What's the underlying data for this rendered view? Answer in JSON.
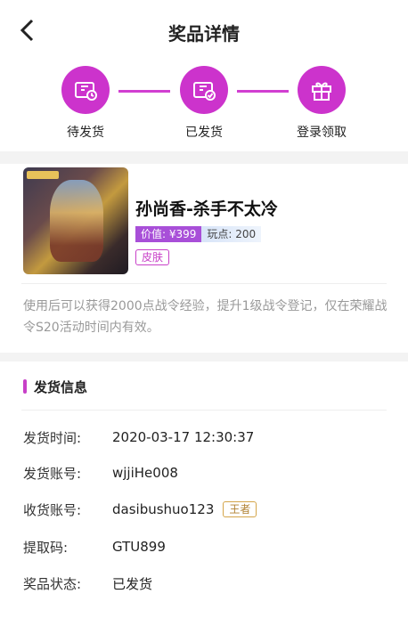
{
  "header": {
    "title": "奖品详情"
  },
  "steps": [
    {
      "label": "待发货",
      "icon": "voucher-clock-icon"
    },
    {
      "label": "已发货",
      "icon": "voucher-check-icon"
    },
    {
      "label": "登录领取",
      "icon": "gift-icon"
    }
  ],
  "product": {
    "name": "孙尚香-杀手不太冷",
    "price": "价值: ¥399",
    "points": "玩点: 200",
    "tag": "皮肤",
    "description": "使用后可以获得2000点战令经验，提升1级战令登记，仅在荣耀战令S20活动时间内有效。"
  },
  "delivery": {
    "title": "发货信息",
    "rows": [
      {
        "key": "发货时间:",
        "value": "2020-03-17 12:30:37"
      },
      {
        "key": "发货账号:",
        "value": "wjjiHe008"
      },
      {
        "key": "收货账号:",
        "value": "dasibushuo123",
        "badge": "王者"
      },
      {
        "key": "提取码:",
        "value": "GTU899"
      },
      {
        "key": "奖品状态:",
        "value": "已发货"
      }
    ]
  },
  "colors": {
    "accent": "#cc33cc",
    "badge": "#d4a54a"
  }
}
